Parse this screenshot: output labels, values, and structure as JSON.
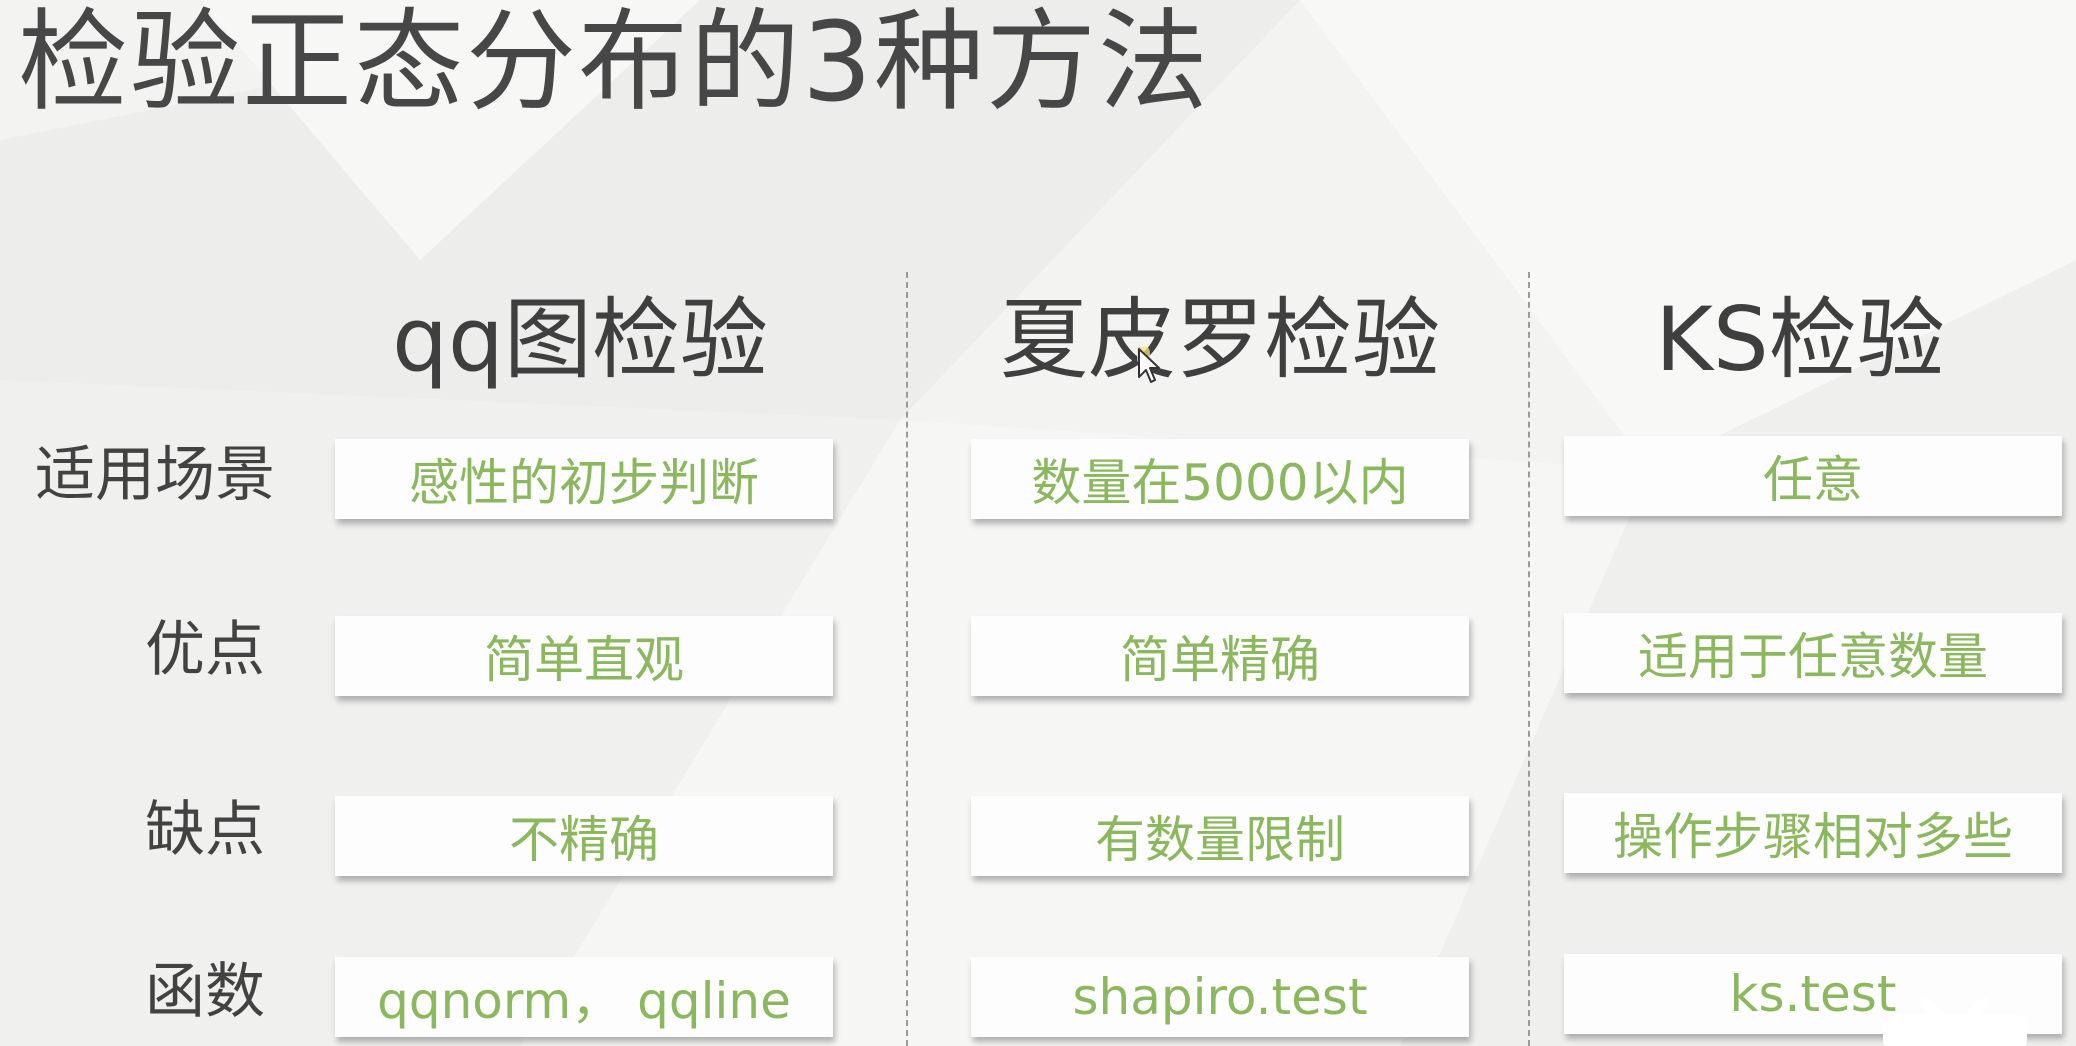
{
  "title": "检验正态分布的3种方法",
  "columns": [
    "qq图检验",
    "夏皮罗检验",
    "KS检验"
  ],
  "rows": [
    {
      "label": "适用场景",
      "cells": [
        "感性的初步判断",
        "数量在5000以内",
        "任意"
      ]
    },
    {
      "label": "优点",
      "cells": [
        "简单直观",
        "简单精确",
        "适用于任意数量"
      ]
    },
    {
      "label": "缺点",
      "cells": [
        "不精确",
        "有数量限制",
        "操作步骤相对多些"
      ]
    },
    {
      "label": "函数",
      "cells": [
        "qqnorm，  qqline",
        "shapiro.test",
        "ks.test"
      ]
    }
  ],
  "colors": {
    "cell_text": "#8bb85e",
    "heading_text": "#3f3f3f",
    "background": "#f3f3f2"
  },
  "icons": [
    "mouse-cursor-icon",
    "partial-logo-icon"
  ]
}
